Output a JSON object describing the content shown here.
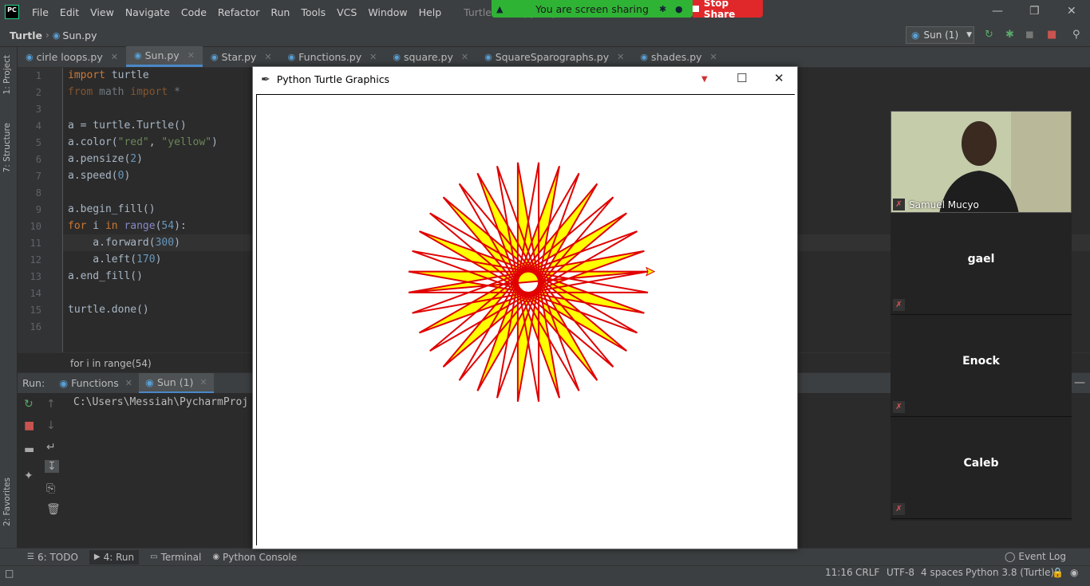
{
  "menubar": {
    "items": [
      "File",
      "Edit",
      "View",
      "Navigate",
      "Code",
      "Refactor",
      "Run",
      "Tools",
      "VCS",
      "Window",
      "Help"
    ],
    "window_title": "Turtle - Sun.py - PyC"
  },
  "share": {
    "banner": "You are screen sharing",
    "stop_label": "Stop Share"
  },
  "nav": {
    "project": "Turtle",
    "file": "Sun.py",
    "run_config": "Sun (1)"
  },
  "left_tools": [
    "1: Project",
    "7: Structure",
    "2: Favorites"
  ],
  "editor_tabs": [
    {
      "label": "cirle loops.py",
      "active": false
    },
    {
      "label": "Sun.py",
      "active": true
    },
    {
      "label": "Star.py",
      "active": false
    },
    {
      "label": "Functions.py",
      "active": false
    },
    {
      "label": "square.py",
      "active": false
    },
    {
      "label": "SquareSparographs.py",
      "active": false
    },
    {
      "label": "shades.py",
      "active": false
    }
  ],
  "code_lines": [
    "import turtle",
    "from math import *",
    "",
    "a = turtle.Turtle()",
    "a.color(\"red\", \"yellow\")",
    "a.pensize(2)",
    "a.speed(0)",
    "",
    "a.begin_fill()",
    "for i in range(54):",
    "    a.forward(300)",
    "    a.left(170)",
    "a.end_fill()",
    "",
    "turtle.done()",
    ""
  ],
  "breadcrumb_context": "for i in range(54)",
  "run": {
    "label": "Run:",
    "tabs": [
      {
        "label": "Functions",
        "active": false
      },
      {
        "label": "Sun (1)",
        "active": true
      }
    ],
    "console": "C:\\Users\\Messiah\\PycharmProj"
  },
  "turtle_window": {
    "title": "Python Turtle Graphics",
    "steps": 54,
    "forward": 300,
    "left_angle": 170,
    "pen_color": "#e00000",
    "fill_color": "#ffff00"
  },
  "bottom_tools": [
    {
      "label": "6: TODO",
      "active": false
    },
    {
      "label": "4: Run",
      "active": true
    },
    {
      "label": "Terminal",
      "active": false
    },
    {
      "label": "Python Console",
      "active": false
    }
  ],
  "event_log": "Event Log",
  "status": {
    "position": "11:16",
    "line_sep": "CRLF",
    "encoding": "UTF-8",
    "indent": "4 spaces",
    "interpreter": "Python 3.8 (Turtle)"
  },
  "participants": [
    {
      "name": "Samuel Mucyo",
      "video": true
    },
    {
      "name": "gael",
      "video": false
    },
    {
      "name": "Enock",
      "video": false
    },
    {
      "name": "Caleb",
      "video": false
    }
  ]
}
